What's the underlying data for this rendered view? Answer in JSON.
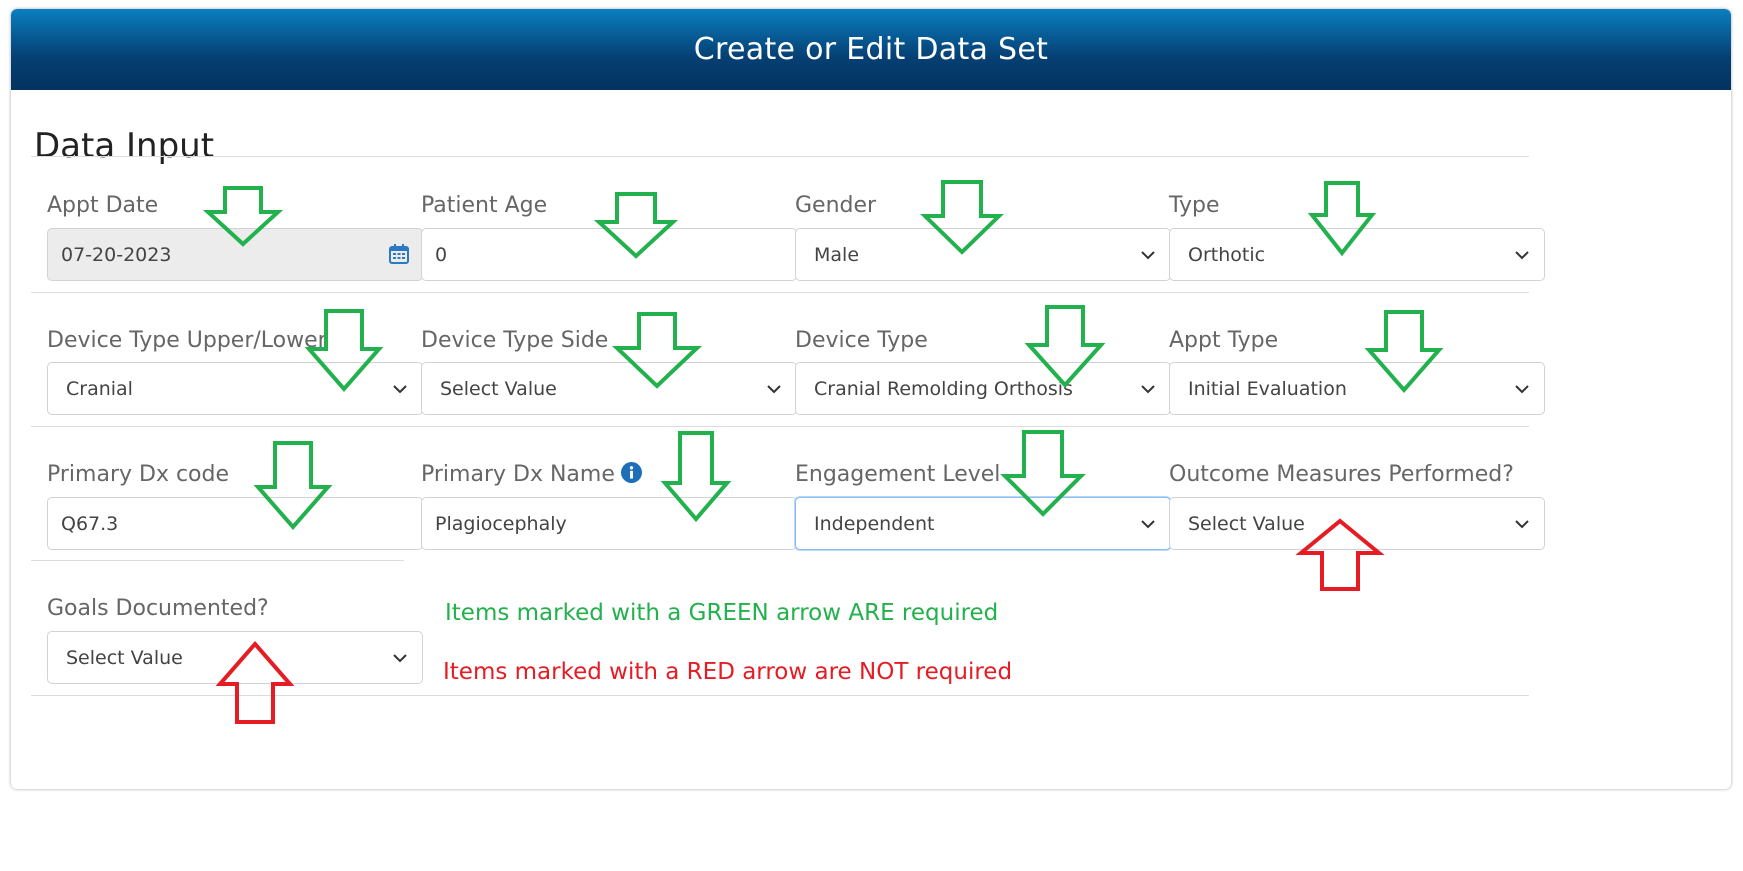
{
  "header": {
    "title": "Create or Edit Data Set"
  },
  "section": {
    "title": "Data Input"
  },
  "fields": {
    "appt_date": {
      "label": "Appt Date",
      "value": "07-20-2023"
    },
    "patient_age": {
      "label": "Patient Age",
      "value": "0"
    },
    "gender": {
      "label": "Gender",
      "value": "Male"
    },
    "type": {
      "label": "Type",
      "value": "Orthotic"
    },
    "device_type_upper_lower": {
      "label": "Device Type Upper/Lower",
      "value": "Cranial"
    },
    "device_type_side": {
      "label": "Device Type Side",
      "value": "Select Value"
    },
    "device_type": {
      "label": "Device Type",
      "value": "Cranial Remolding Orthosis"
    },
    "appt_type": {
      "label": "Appt Type",
      "value": "Initial Evaluation"
    },
    "primary_dx_code": {
      "label": "Primary Dx code",
      "value": "Q67.3"
    },
    "primary_dx_name": {
      "label": "Primary Dx Name",
      "value": "Plagiocephaly"
    },
    "engagement_level": {
      "label": "Engagement Level",
      "value": "Independent"
    },
    "outcome_measures": {
      "label": "Outcome Measures Performed?",
      "value": "Select Value"
    },
    "goals_documented": {
      "label": "Goals Documented?",
      "value": "Select Value"
    }
  },
  "notes": {
    "green": "Items marked with a GREEN arrow ARE required",
    "red": "Items marked with a RED arrow are NOT required"
  },
  "colors": {
    "header_top": "#0a7fc0",
    "header_bottom": "#04335f",
    "green_arrow": "#22b14c",
    "red_arrow": "#e51c23",
    "info_icon": "#1f6fb8",
    "calendar_icon": "#2b78c5"
  },
  "icons": {
    "calendar": "calendar-icon",
    "chevron": "chevron-down-icon",
    "info": "info-icon",
    "required": "green-down-arrow-icon",
    "optional": "red-up-arrow-icon"
  }
}
